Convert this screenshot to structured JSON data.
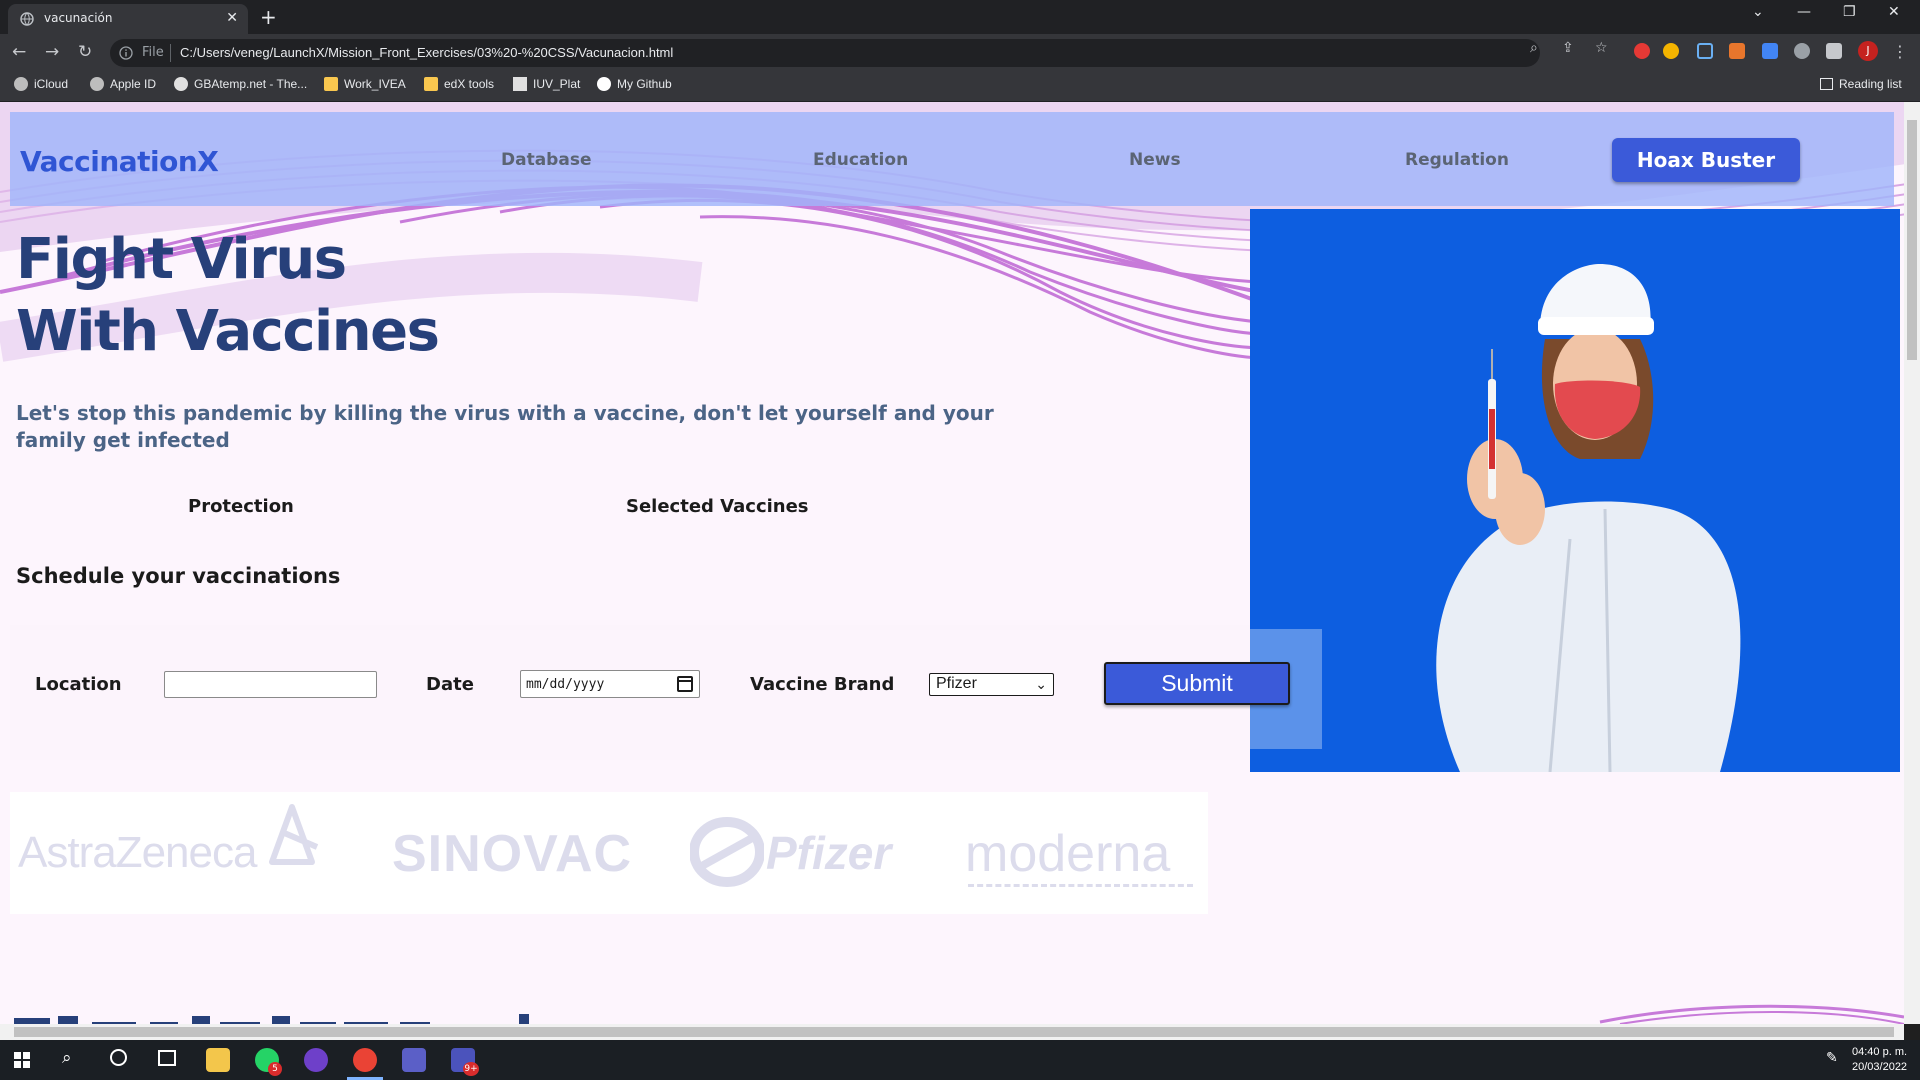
{
  "browser": {
    "tab_title": "vacunación",
    "new_tab": "+",
    "url_scheme": "File",
    "url": "C:/Users/veneg/LaunchX/Mission_Front_Exercises/03%20-%20CSS/Vacunacion.html",
    "bookmarks": [
      "iCloud",
      "Apple ID",
      "GBAtemp.net - The...",
      "Work_IVEA",
      "edX tools",
      "IUV_Plat",
      "My Github"
    ],
    "reading_list": "Reading list",
    "profile_initial": "J"
  },
  "page": {
    "logo": "VaccinationX",
    "nav": [
      "Database",
      "Education",
      "News",
      "Regulation"
    ],
    "cta": "Hoax Buster",
    "hero_line1": "Fight Virus",
    "hero_line2": "With Vaccines",
    "lead": "Let's stop this pandemic by killing the virus with a vaccine, don't let yourself and your family get infected",
    "subheads": [
      "Protection",
      "Selected Vaccines"
    ],
    "schedule_heading": "Schedule your vaccinations",
    "form": {
      "location_label": "Location",
      "location_value": "",
      "date_label": "Date",
      "date_placeholder": "mm/dd/yyyy",
      "brand_label": "Vaccine Brand",
      "brand_selected": "Pfizer",
      "submit": "Submit"
    },
    "brands": [
      "AstraZeneca",
      "SINOVAC",
      "Pfizer",
      "moderna"
    ]
  },
  "taskbar": {
    "whatsapp_badge": "5",
    "teams_badge": "9+",
    "time": "04:40 p. m.",
    "date": "20/03/2022"
  },
  "colors": {
    "accent": "#3b5ad9",
    "heading": "#27407a",
    "header_band": "#a0b4fa",
    "photo_bg": "#0d5ee0"
  }
}
